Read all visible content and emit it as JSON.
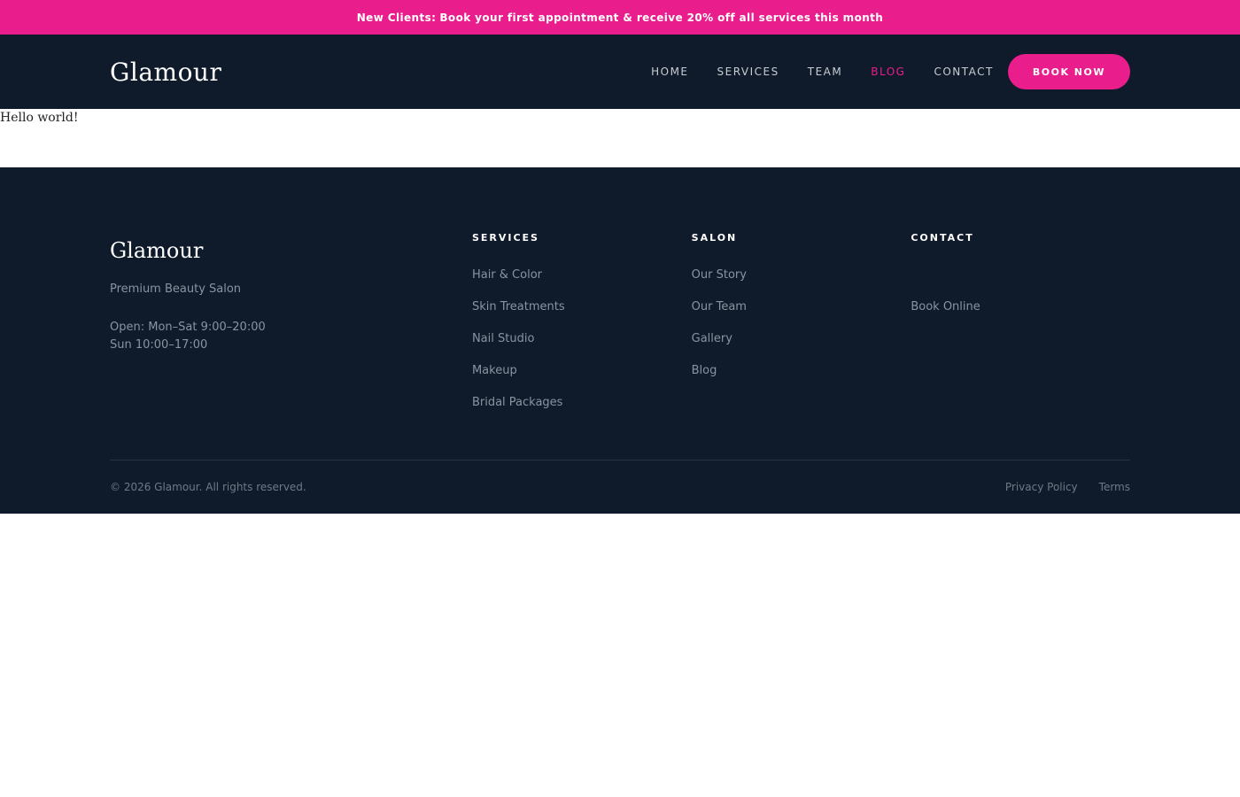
{
  "promo": {
    "strong": "New Clients:",
    "text": "Book your first appointment & receive 20% off all services this month"
  },
  "header": {
    "logo": "Glamour",
    "nav": [
      "HOME",
      "SERVICES",
      "TEAM",
      "BLOG",
      "CONTACT"
    ],
    "active_nav": "BLOG",
    "book_label": "BOOK NOW"
  },
  "main": {
    "content": "Hello world!"
  },
  "footer": {
    "logo": "Glamour",
    "tagline": "Premium Beauty Salon",
    "hours_line1": "Open: Mon–Sat 9:00–20:00",
    "hours_line2": "Sun 10:00–17:00",
    "services": {
      "heading": "SERVICES",
      "links": [
        "Hair & Color",
        "Skin Treatments",
        "Nail Studio",
        "Makeup",
        "Bridal Packages"
      ]
    },
    "salon": {
      "heading": "SALON",
      "links": [
        "Our Story",
        "Our Team",
        "Gallery",
        "Blog"
      ]
    },
    "contact": {
      "heading": "CONTACT",
      "link": "Book Online"
    },
    "copyright": "© 2026 Glamour. All rights reserved.",
    "legal": [
      "Privacy Policy",
      "Terms"
    ]
  },
  "colors": {
    "accent": "#e91e8c",
    "navy": "#0f1b2b"
  }
}
